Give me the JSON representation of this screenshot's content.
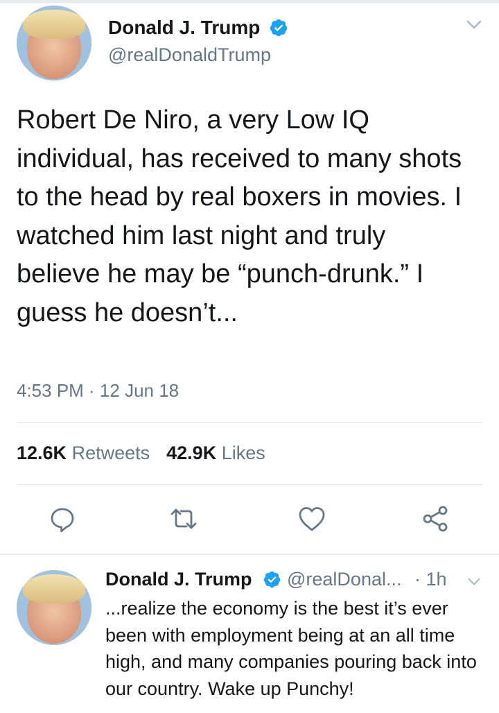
{
  "main_tweet": {
    "author_name": "Donald J. Trump",
    "author_handle": "@realDonaldTrump",
    "text": "Robert De Niro, a very Low IQ individual, has received to many shots to the head by real boxers in movies. I watched him last night and truly believe he may be “punch-drunk.” I guess he doesn’t...",
    "timestamp": "4:53 PM · 12 Jun 18",
    "retweets_count": "12.6K",
    "retweets_label": "Retweets",
    "likes_count": "42.9K",
    "likes_label": "Likes"
  },
  "reply_tweet": {
    "author_name": "Donald J. Trump",
    "author_handle": "@realDonal...",
    "time_ago": "· 1h",
    "text": "...realize the economy is the best it’s ever been with employment being at an all time high, and many companies pouring back into our country. Wake up Punchy!"
  },
  "icons": {
    "verified": "verified-badge-icon",
    "menu": "chevron-down-icon",
    "reply": "reply-icon",
    "retweet": "retweet-icon",
    "like": "heart-icon",
    "share": "share-icon"
  },
  "colors": {
    "verified_blue": "#1da1f2",
    "text_primary": "#14171a",
    "text_secondary": "#657786",
    "icon_gray": "#657786",
    "divider": "#e1e8ed"
  }
}
